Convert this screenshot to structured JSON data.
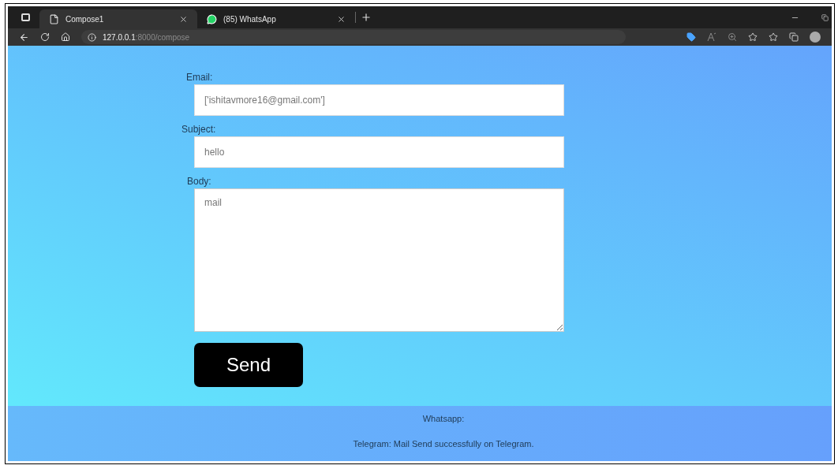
{
  "browser": {
    "tabs": [
      {
        "title": "Compose1",
        "kind": "page",
        "selected": true
      },
      {
        "title": "(85) WhatsApp",
        "kind": "whatsapp",
        "selected": false
      }
    ],
    "address": {
      "host": "127.0.0.1",
      "path": ":8000/compose"
    }
  },
  "form": {
    "fields": [
      {
        "label": "Email:",
        "value": "['ishitavmore16@gmail.com']",
        "kind": "input"
      },
      {
        "label": "Subject:",
        "value": "hello",
        "kind": "input"
      },
      {
        "label": "Body:",
        "value": "mail",
        "kind": "textarea"
      }
    ],
    "button": "Send"
  },
  "footer": {
    "messages": [
      "Whatsapp:",
      "Telegram: Mail Send successfully on Telegram."
    ]
  }
}
